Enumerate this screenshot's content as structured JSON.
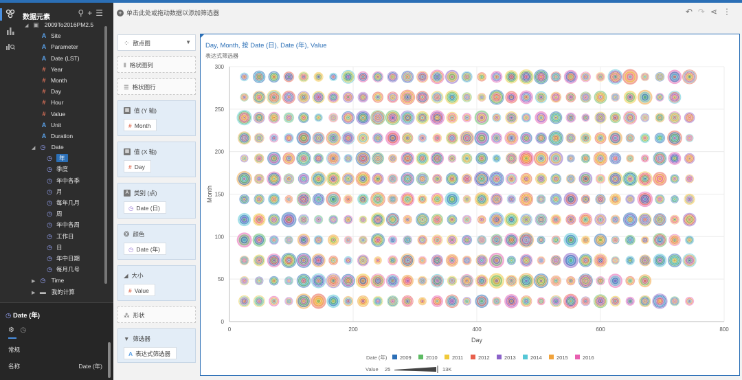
{
  "sidebar": {
    "title": "数据元素",
    "dataset": "2009To2016PM2.5",
    "fields": [
      {
        "type": "A",
        "label": "Site"
      },
      {
        "type": "A",
        "label": "Parameter"
      },
      {
        "type": "A",
        "label": "Date (LST)"
      },
      {
        "type": "#",
        "label": "Year"
      },
      {
        "type": "#",
        "label": "Month"
      },
      {
        "type": "#",
        "label": "Day"
      },
      {
        "type": "#",
        "label": "Hour"
      },
      {
        "type": "#",
        "label": "Value"
      },
      {
        "type": "A",
        "label": "Unit"
      },
      {
        "type": "A",
        "label": "Duration"
      }
    ],
    "date_group": "Date",
    "date_children": [
      "年",
      "季度",
      "年中各季",
      "月",
      "每年几月",
      "周",
      "年中各周",
      "工作日",
      "日",
      "年中日期",
      "每月几号"
    ],
    "time_group": "Time",
    "my_calc": "我的计算",
    "bottom": {
      "title": "Date (年)",
      "section": "常规",
      "name_label": "名称",
      "name_value": "Date (年)"
    }
  },
  "filterbar": {
    "text": "单击此处或拖动数据以添加筛选器"
  },
  "shelf": {
    "chart_type": "散点图",
    "grid_columns": "格状图列",
    "grid_rows": "格状图行",
    "y_axis": {
      "title": "值 (Y 轴)",
      "pill": "Month"
    },
    "x_axis": {
      "title": "值 (X 轴)",
      "pill": "Day"
    },
    "category": {
      "title": "类别 (点)",
      "pill": "Date (日)"
    },
    "color": {
      "title": "颜色",
      "pill": "Date (年)"
    },
    "size": {
      "title": "大小",
      "pill": "Value"
    },
    "shape": "形状",
    "filter": {
      "title": "筛选器",
      "pill": "表达式筛选器"
    }
  },
  "chart": {
    "title": "Day, Month, 按 Date (日), Date (年), Value",
    "subtitle": "表达式筛选器"
  },
  "chart_data": {
    "type": "scatter",
    "xlabel": "Day",
    "ylabel": "Month",
    "xlim": [
      0,
      800
    ],
    "ylim": [
      0,
      300
    ],
    "xticks": [
      0,
      200,
      400,
      600,
      800
    ],
    "yticks": [
      0,
      50,
      100,
      150,
      200,
      250,
      300
    ],
    "rows_y": [
      24,
      48,
      72,
      96,
      120,
      144,
      168,
      192,
      216,
      240,
      264,
      288
    ],
    "rows_xmax": [
      750,
      695,
      750,
      750,
      750,
      750,
      750,
      750,
      750,
      750,
      730,
      750
    ],
    "legend_title": "Date (年)",
    "years": [
      "2009",
      "2010",
      "2011",
      "2012",
      "2013",
      "2014",
      "2015",
      "2016"
    ],
    "year_colors": [
      "#2c6fb7",
      "#5dbb63",
      "#f0c93a",
      "#e8604c",
      "#8b62c9",
      "#55c7d6",
      "#f1a33b",
      "#e85fb0"
    ],
    "size_legend": {
      "label": "Value",
      "min": "25",
      "max": "13K"
    }
  }
}
